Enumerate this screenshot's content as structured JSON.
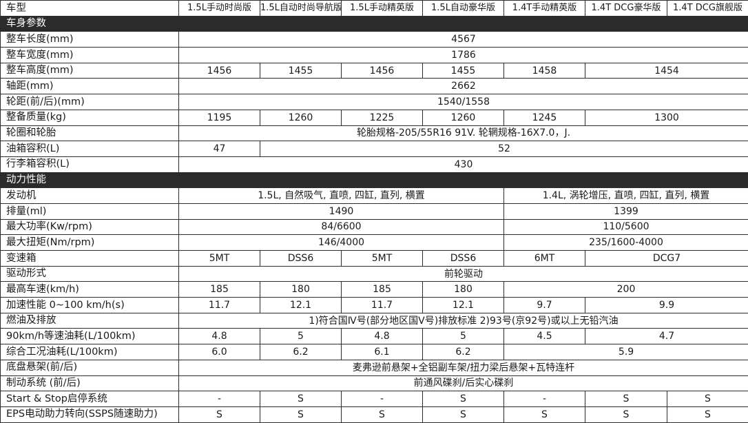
{
  "header": {
    "label": "车型",
    "models": [
      "1.5L手动时尚版",
      "1.5L自动时尚导航版",
      "1.5L手动精英版",
      "1.5L自动豪华版",
      "1.4T手动精英版",
      "1.4T DCG豪华版",
      "1.4T DCG旗舰版"
    ]
  },
  "sections": {
    "body": "车身参数",
    "power": "动力性能"
  },
  "body_rows": {
    "length": {
      "label": "整车长度(mm)",
      "value": "4567"
    },
    "width": {
      "label": "整车宽度(mm)",
      "value": "1786"
    },
    "height": {
      "label": "整车高度(mm)",
      "values": [
        "1456",
        "1455",
        "1456",
        "1455",
        "1458",
        "1454"
      ]
    },
    "wheelbase": {
      "label": "轴距(mm)",
      "value": "2662"
    },
    "track": {
      "label": "轮距(前/后)(mm)",
      "value": "1540/1558"
    },
    "curb_weight": {
      "label": "整备质量(kg)",
      "values": [
        "1195",
        "1260",
        "1225",
        "1260",
        "1245",
        "1300"
      ]
    },
    "wheels": {
      "label": "轮圈和轮胎",
      "value": "轮胎规格-205/55R16 91V. 轮辋规格-16X7.0，J."
    },
    "fuel_tank": {
      "label": "油箱容积(L)",
      "values": [
        "47",
        "52"
      ]
    },
    "trunk": {
      "label": "行李箱容积(L)",
      "value": "430"
    }
  },
  "power_rows": {
    "engine": {
      "label": "发动机",
      "values": [
        "1.5L, 自然吸气, 直喷, 四缸, 直列, 横置",
        "1.4L, 涡轮增压, 直喷, 四缸, 直列, 横置"
      ]
    },
    "displacement": {
      "label": "排量(ml)",
      "values": [
        "1490",
        "1399"
      ]
    },
    "max_power": {
      "label": "最大功率(Kw/rpm)",
      "values": [
        "84/6600",
        "110/5600"
      ]
    },
    "max_torque": {
      "label": "最大扭矩(Nm/rpm)",
      "values": [
        "146/4000",
        "235/1600-4000"
      ]
    },
    "transmission": {
      "label": "变速箱",
      "values": [
        "5MT",
        "DSS6",
        "5MT",
        "DSS6",
        "6MT",
        "DCG7"
      ]
    },
    "drive": {
      "label": "驱动形式",
      "value": "前轮驱动"
    },
    "top_speed": {
      "label": "最高车速(km/h)",
      "values": [
        "185",
        "180",
        "185",
        "180",
        "200"
      ]
    },
    "acceleration": {
      "label": "加速性能 0~100 km/h(s)",
      "values": [
        "11.7",
        "12.1",
        "11.7",
        "12.1",
        "9.7",
        "9.9"
      ]
    },
    "fuel_emission": {
      "label": "燃油及排放",
      "value": "1)符合国Ⅳ号(部分地区国Ⅴ号)排放标准  2)93号(京92号)或以上无铅汽油"
    },
    "consumption_90": {
      "label": "90km/h等速油耗(L/100km)",
      "values": [
        "4.8",
        "5",
        "4.8",
        "5",
        "4.5",
        "4.7"
      ]
    },
    "consumption_combined": {
      "label": "综合工况油耗(L/100km)",
      "values": [
        "6.0",
        "6.2",
        "6.1",
        "6.2",
        "5.9"
      ]
    },
    "suspension": {
      "label": "底盘悬架(前/后)",
      "value": "麦弗逊前悬架+全铝副车架/扭力梁后悬架+瓦特连杆"
    },
    "brakes": {
      "label": "制动系统 (前/后)",
      "value": "前通风碟刹/后实心碟刹"
    },
    "start_stop": {
      "label": "Start & Stop启停系统",
      "values": [
        "-",
        "S",
        "-",
        "S",
        "-",
        "S",
        "S"
      ]
    },
    "eps": {
      "label": "EPS电动助力转向(SSPS随速助力)",
      "values": [
        "S",
        "S",
        "S",
        "S",
        "S",
        "S",
        "S"
      ]
    }
  }
}
